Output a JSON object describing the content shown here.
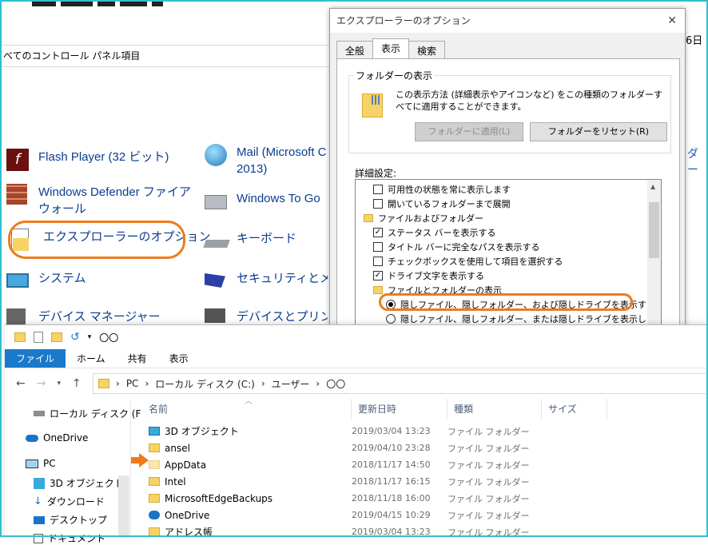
{
  "control_panel": {
    "breadcrumb": "べてのコントロール パネル項目",
    "right_text_1": "6日",
    "right_text_2": "ダー",
    "items": [
      {
        "label": "Flash Player (32 ビット)",
        "icon": "flash-icon"
      },
      {
        "label": "Mail (Microsoft C",
        "label2": "2013)",
        "icon": "mail-icon"
      },
      {
        "label": "Windows Defender ファイア",
        "label2": "ウォール",
        "icon": "firewall-icon"
      },
      {
        "label": "Windows To Go",
        "icon": "usb-drive-icon"
      },
      {
        "label": "エクスプローラーのオプション",
        "icon": "folder-options-icon"
      },
      {
        "label": "キーボード",
        "icon": "keyboard-icon"
      },
      {
        "label": "システム",
        "icon": "monitor-icon"
      },
      {
        "label": "セキュリティとメンテ",
        "icon": "flag-icon"
      },
      {
        "label": "デバイス マネージャー",
        "icon": "device-manager-icon"
      },
      {
        "label": "デバイスとプリンター",
        "icon": "printer-icon"
      }
    ]
  },
  "dialog": {
    "title": "エクスプローラーのオプション",
    "close": "✕",
    "tabs": [
      "全般",
      "表示",
      "検索"
    ],
    "active_tab": "表示",
    "folder_view": {
      "group_title": "フォルダーの表示",
      "description": "この表示方法 (詳細表示やアイコンなど) をこの種類のフォルダーすべてに適用することができます。",
      "apply_button": "フォルダーに適用(L)",
      "reset_button": "フォルダーをリセット(R)"
    },
    "advanced_label": "詳細設定:",
    "settings": [
      {
        "type": "checkbox",
        "checked": false,
        "label": "可用性の状態を常に表示します",
        "indent": 1
      },
      {
        "type": "checkbox",
        "checked": false,
        "label": "開いているフォルダーまで展開",
        "indent": 1
      },
      {
        "type": "folder",
        "label": "ファイルおよびフォルダー",
        "indent": 0
      },
      {
        "type": "checkbox",
        "checked": true,
        "label": "ステータス バーを表示する",
        "indent": 1
      },
      {
        "type": "checkbox",
        "checked": false,
        "label": "タイトル バーに完全なパスを表示する",
        "indent": 1
      },
      {
        "type": "checkbox",
        "checked": false,
        "label": "チェックボックスを使用して項目を選択する",
        "indent": 1
      },
      {
        "type": "checkbox",
        "checked": true,
        "label": "ドライブ文字を表示する",
        "indent": 1
      },
      {
        "type": "folder",
        "label": "ファイルとフォルダーの表示",
        "indent": 1
      },
      {
        "type": "radio",
        "checked": true,
        "label": "隠しファイル、隠しフォルダー、および隠しドライブを表示する",
        "indent": 2
      },
      {
        "type": "radio",
        "checked": false,
        "label": "隠しファイル、隠しフォルダー、または隠しドライブを表示しない",
        "indent": 2
      }
    ]
  },
  "explorer": {
    "window_title": "〇〇",
    "ribbon_tabs": [
      "ファイル",
      "ホーム",
      "共有",
      "表示"
    ],
    "address": [
      "PC",
      "ローカル ディスク (C:)",
      "ユーザー",
      "〇〇"
    ],
    "left_pane": [
      {
        "label": "ローカル ディスク (F",
        "icon": "drive-icon"
      },
      {
        "label": "OneDrive",
        "icon": "onedrive-icon"
      },
      {
        "label": "PC",
        "icon": "pc-icon"
      },
      {
        "label": "3D オブジェクト",
        "icon": "cube-icon"
      },
      {
        "label": "ダウンロード",
        "icon": "download-icon"
      },
      {
        "label": "デスクトップ",
        "icon": "desktop-icon"
      },
      {
        "label": "ドキュメント",
        "icon": "documents-icon"
      }
    ],
    "columns": [
      "名前",
      "更新日時",
      "種類",
      "サイズ"
    ],
    "files": [
      {
        "name": "3D オブジェクト",
        "date": "2019/03/04 13:23",
        "type": "ファイル フォルダー",
        "icon": "cube"
      },
      {
        "name": "ansel",
        "date": "2019/04/10 23:28",
        "type": "ファイル フォルダー",
        "icon": "folder"
      },
      {
        "name": "AppData",
        "date": "2018/11/17 14:50",
        "type": "ファイル フォルダー",
        "icon": "folder-hidden"
      },
      {
        "name": "Intel",
        "date": "2018/11/17 16:15",
        "type": "ファイル フォルダー",
        "icon": "folder"
      },
      {
        "name": "MicrosoftEdgeBackups",
        "date": "2018/11/18 16:00",
        "type": "ファイル フォルダー",
        "icon": "folder"
      },
      {
        "name": "OneDrive",
        "date": "2019/04/15 10:29",
        "type": "ファイル フォルダー",
        "icon": "cloud"
      },
      {
        "name": "アドレス帳",
        "date": "2019/03/04 13:23",
        "type": "ファイル フォルダー",
        "icon": "folder"
      }
    ]
  },
  "colors": {
    "highlight": "#f07a1a",
    "frame": "#2fbfd0",
    "ribbon_file": "#1979ca"
  }
}
